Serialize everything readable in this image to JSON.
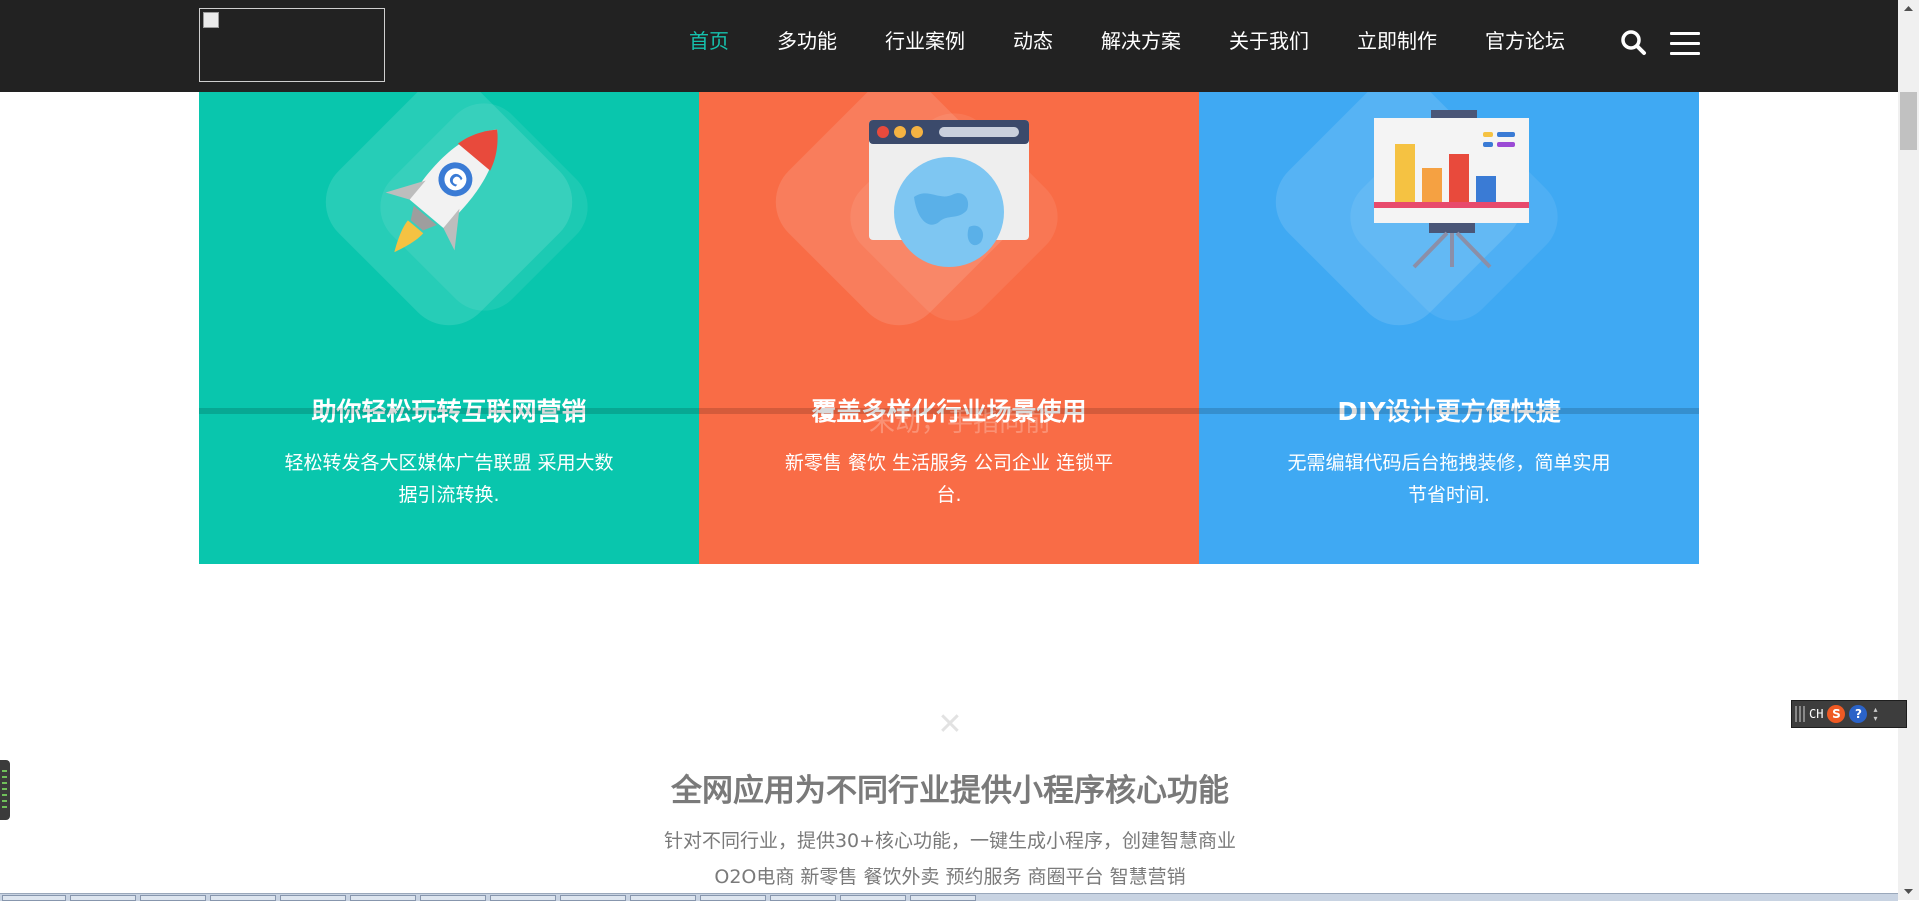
{
  "header": {
    "logo_alt": "",
    "nav": [
      {
        "label": "首页",
        "active": true
      },
      {
        "label": "多功能",
        "active": false
      },
      {
        "label": "行业案例",
        "active": false
      },
      {
        "label": "动态",
        "active": false
      },
      {
        "label": "解决方案",
        "active": false
      },
      {
        "label": "关于我们",
        "active": false
      },
      {
        "label": "立即制作",
        "active": false
      },
      {
        "label": "官方论坛",
        "active": false
      }
    ],
    "search_icon": "search-icon",
    "menu_icon": "hamburger-menu-icon",
    "accent_color": "#16c1ad"
  },
  "features": [
    {
      "title": "助你轻松玩转互联网营销",
      "desc": "轻松转发各大区媒体广告联盟 采用大数据引流转换.",
      "color": "#09c6ad",
      "icon": "rocket-icon"
    },
    {
      "title": "覆盖多样化行业场景使用",
      "desc": "新零售 餐饮 生活服务 公司企业 连锁平台.",
      "color": "#f96c46",
      "icon": "browser-globe-icon"
    },
    {
      "title": "DIY设计更方便快捷",
      "desc": "无需编辑代码后台拖拽装修，简单实用节省时间.",
      "color": "#3fa9f3",
      "icon": "presentation-chart-icon"
    }
  ],
  "overlay": {
    "watermark": "未动，手指向前"
  },
  "section": {
    "title": "全网应用为不同行业提供小程序核心功能",
    "line1": "针对不同行业，提供30+核心功能，一键生成小程序，创建智慧商业",
    "line2": "O2O电商 新零售 餐饮外卖 预约服务 商圈平台 智慧营销"
  },
  "ime": {
    "lang": "CH",
    "logo": "S",
    "help": "?"
  }
}
